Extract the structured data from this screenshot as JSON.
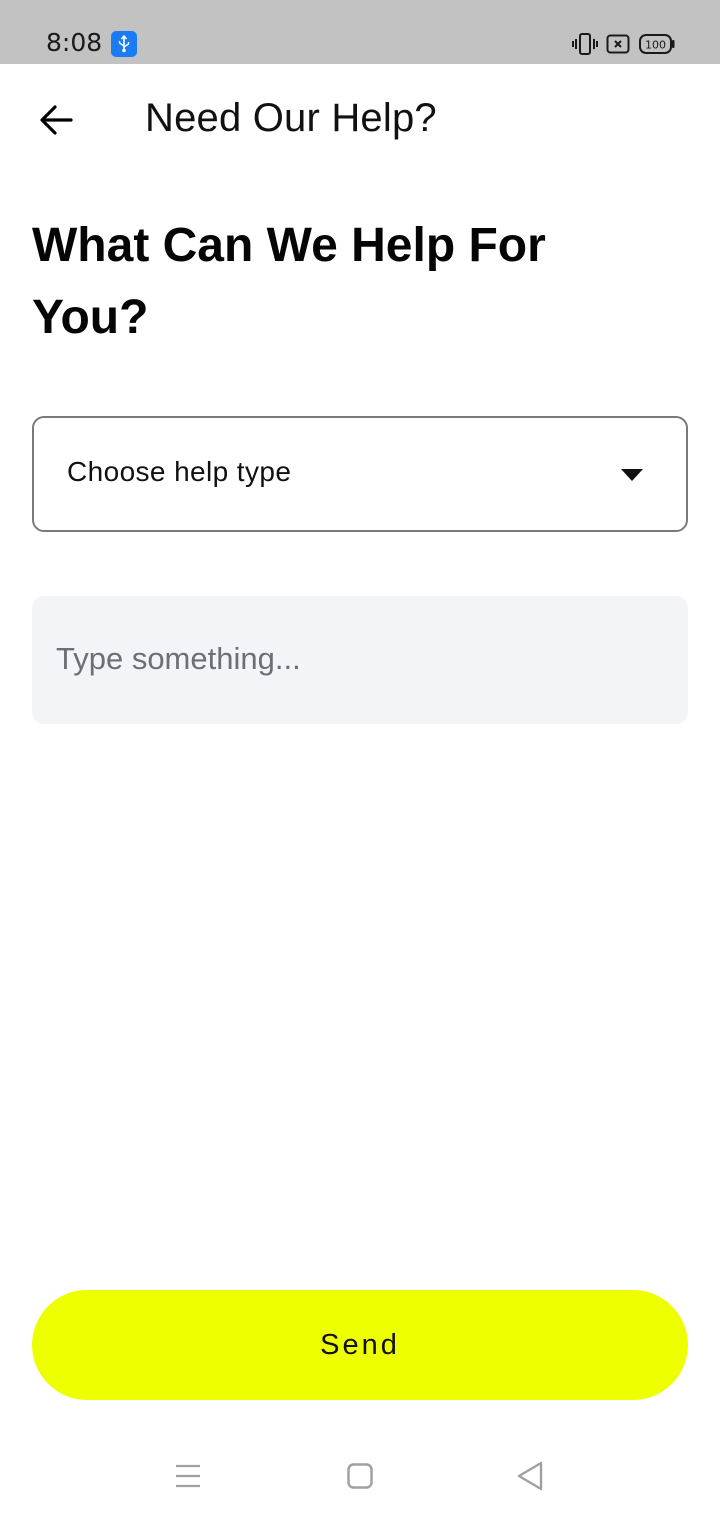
{
  "status_bar": {
    "time": "8:08",
    "battery": "100",
    "icons": [
      "usb-icon",
      "vibrate-icon",
      "sim-icon",
      "battery-icon"
    ]
  },
  "app_bar": {
    "back_icon": "arrow-left-icon",
    "title": "Need Our Help?"
  },
  "main": {
    "heading": "What Can We Help For You?",
    "dropdown": {
      "selected": "Choose help type",
      "icon": "caret-down-icon"
    },
    "message": {
      "placeholder": "Type something...",
      "value": ""
    },
    "send_label": "Send"
  },
  "nav_bar": {
    "icons": [
      "menu-icon",
      "home-icon",
      "back-triangle-icon"
    ]
  },
  "colors": {
    "status_bar_bg": "#c2c2c2",
    "accent": "#eeff00",
    "input_bg": "#f3f4f7",
    "usb_badge": "#1a7cf5"
  }
}
